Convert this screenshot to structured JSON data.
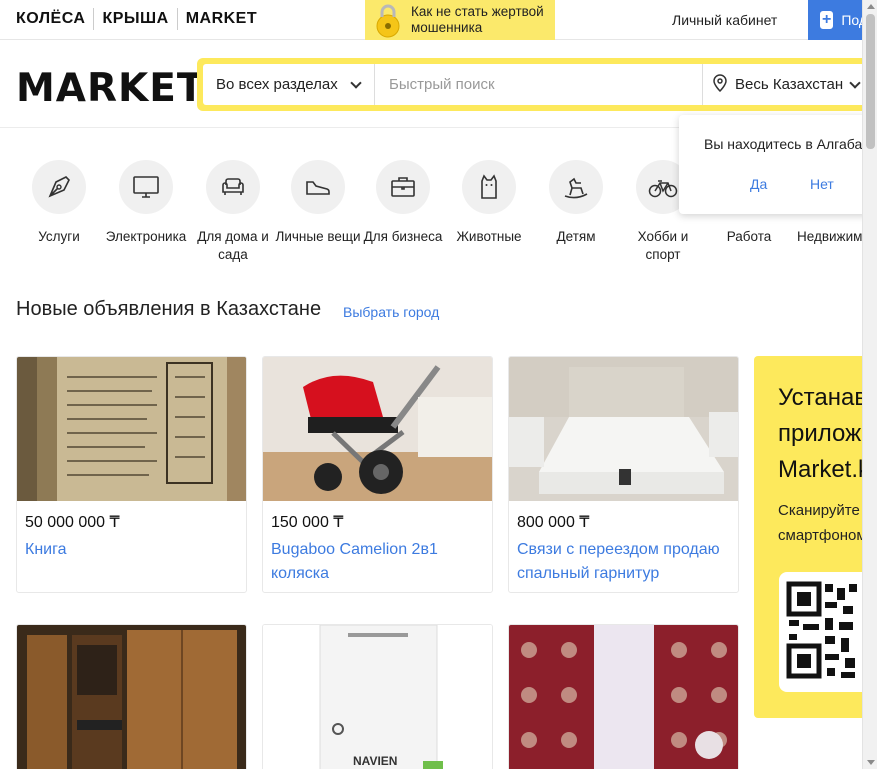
{
  "topbar": {
    "brands": [
      "КОЛЁСА",
      "КРЫША",
      "MARKET"
    ],
    "promo_text_line1": "Как не стать жертвой",
    "promo_text_line2": "мошенника",
    "cabinet_label": "Личный кабинет",
    "post_button_label": "Подать объявление"
  },
  "header": {
    "logo": "MARKET",
    "sections_label": "Во всех разделах",
    "search_placeholder": "Быстрый поиск",
    "region_label": "Весь Казахстан"
  },
  "categories": [
    {
      "label": "Услуги",
      "icon": "pen-nib-icon"
    },
    {
      "label": "Электроника",
      "icon": "monitor-icon"
    },
    {
      "label": "Для дома и сада",
      "icon": "sofa-icon"
    },
    {
      "label": "Личные вещи",
      "icon": "sneaker-icon"
    },
    {
      "label": "Для бизнеса",
      "icon": "briefcase-icon"
    },
    {
      "label": "Животные",
      "icon": "cat-icon"
    },
    {
      "label": "Детям",
      "icon": "rocking-horse-icon"
    },
    {
      "label": "Хобби и спорт",
      "icon": "bicycle-icon"
    },
    {
      "label": "Работа",
      "icon": "work-icon"
    },
    {
      "label": "Недвижимость",
      "icon": "building-icon"
    }
  ],
  "geo_popup": {
    "question": "Вы находитесь в Алгабасе?",
    "yes": "Да",
    "no": "Нет"
  },
  "listings_section": {
    "title": "Новые объявления в Казахстане",
    "choose_city": "Выбрать город"
  },
  "listings": [
    {
      "price": "50 000 000 ₸",
      "title": "Книга",
      "image": "old-manuscript-book"
    },
    {
      "price": "150 000 ₸",
      "title": "Bugaboo Camelion 2в1 коляска",
      "image": "stroller"
    },
    {
      "price": "800 000 ₸",
      "title": "Связи с переездом продаю спальный гарнитур",
      "image": "bed"
    },
    {
      "price": "",
      "title": "",
      "image": "wardrobe"
    },
    {
      "price": "",
      "title": "",
      "image": "navien-boiler"
    },
    {
      "price": "",
      "title": "",
      "image": "curtains"
    }
  ],
  "app_promo": {
    "title_line1": "Устанавливайте",
    "title_line2": "приложение",
    "title_line3": "Market.kz",
    "sub_line1": "Сканируйте QR-код",
    "sub_line2": "смартфоном"
  },
  "colors": {
    "accent_blue": "#3d7be0",
    "brand_yellow": "#fde95c"
  }
}
